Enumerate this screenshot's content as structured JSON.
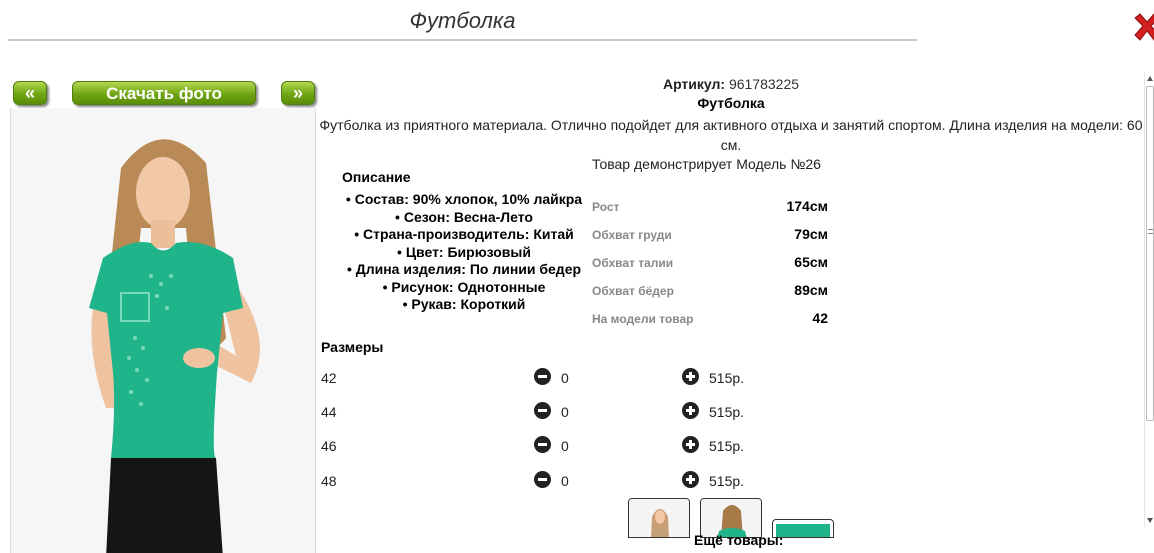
{
  "page": {
    "title": "Футболка"
  },
  "gallery": {
    "prev_label": "«",
    "download_label": "Скачать фото",
    "next_label": "»"
  },
  "product": {
    "article_label": "Артикул:",
    "article_value": "961783225",
    "name": "Футболка",
    "description": "Футболка из приятного материала. Отлично подойдет для активного отдыха и занятий спортом. Длина изделия на модели: 60 см.",
    "model_demo": "Товар демонстрирует Модель №26"
  },
  "description": {
    "heading": "Описание",
    "features": [
      "Состав: 90% хлопок, 10% лайкра",
      "Сезон: Весна-Лето",
      "Страна-производитель: Китай",
      "Цвет: Бирюзовый",
      "Длина изделия: По линии бедер",
      "Рисунок: Однотонные",
      "Рукав: Короткий"
    ]
  },
  "model": {
    "rows": [
      {
        "label": "Рост",
        "value": "174см"
      },
      {
        "label": "Обхват груди",
        "value": "79см"
      },
      {
        "label": "Обхват талии",
        "value": "65см"
      },
      {
        "label": "Обхват бёдер",
        "value": "89см"
      },
      {
        "label": "На модели товар",
        "value": "42"
      }
    ]
  },
  "sizes": {
    "heading": "Размеры",
    "rows": [
      {
        "size": "42",
        "qty": "0",
        "price": "515р."
      },
      {
        "size": "44",
        "qty": "0",
        "price": "515р."
      },
      {
        "size": "46",
        "qty": "0",
        "price": "515р."
      },
      {
        "size": "48",
        "qty": "0",
        "price": "515р."
      }
    ]
  },
  "more_products": {
    "label": "Ещё товары:"
  },
  "colors": {
    "accent_green": "#6fa514",
    "shirt": "#1fb48a",
    "close_red": "#d41f1f"
  }
}
